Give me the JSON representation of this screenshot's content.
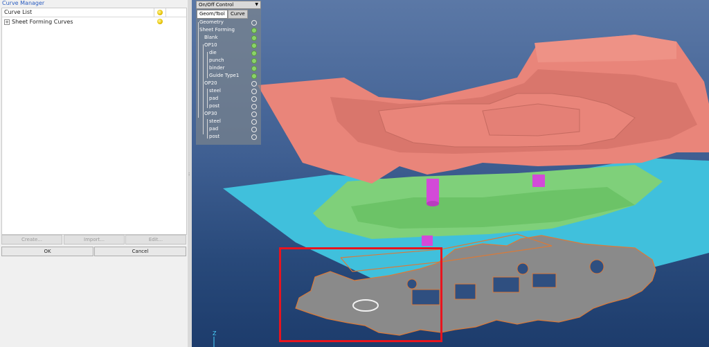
{
  "panel": {
    "title": "Curve Manager",
    "list_header": "Curve List",
    "items": [
      {
        "label": "Sheet Forming Curves",
        "expander": "+"
      }
    ],
    "buttons": {
      "create": "Create...",
      "import": "Import...",
      "edit": "Edit...",
      "ok": "OK",
      "cancel": "Cancel"
    }
  },
  "onoff": {
    "dropdown": "On/Off Control",
    "tabs": [
      "Geom/Tool",
      "Curve"
    ],
    "rows": [
      {
        "label": "Geometry",
        "state": "off"
      },
      {
        "label": "Sheet Forming",
        "state": "on"
      },
      {
        "label": "Blank",
        "state": "on"
      },
      {
        "label": "OP10",
        "state": "on"
      },
      {
        "label": "die",
        "state": "on"
      },
      {
        "label": "punch",
        "state": "on"
      },
      {
        "label": "binder",
        "state": "on"
      },
      {
        "label": "Guide Type1",
        "state": "on"
      },
      {
        "label": "OP20",
        "state": "off"
      },
      {
        "label": "steel",
        "state": "off"
      },
      {
        "label": "pad",
        "state": "off"
      },
      {
        "label": "post",
        "state": "off"
      },
      {
        "label": "OP30",
        "state": "off"
      },
      {
        "label": "steel",
        "state": "off"
      },
      {
        "label": "pad",
        "state": "off"
      },
      {
        "label": "post",
        "state": "off"
      }
    ]
  },
  "axis_label": "Z",
  "colors": {
    "die": "#e9857a",
    "binder": "#7fd07a",
    "blank": "#40c0dc",
    "guide": "#d34ad8",
    "curve_outline": "#d97a3a",
    "highlight": "#e8141e",
    "on_dot": "#8bd36a"
  }
}
